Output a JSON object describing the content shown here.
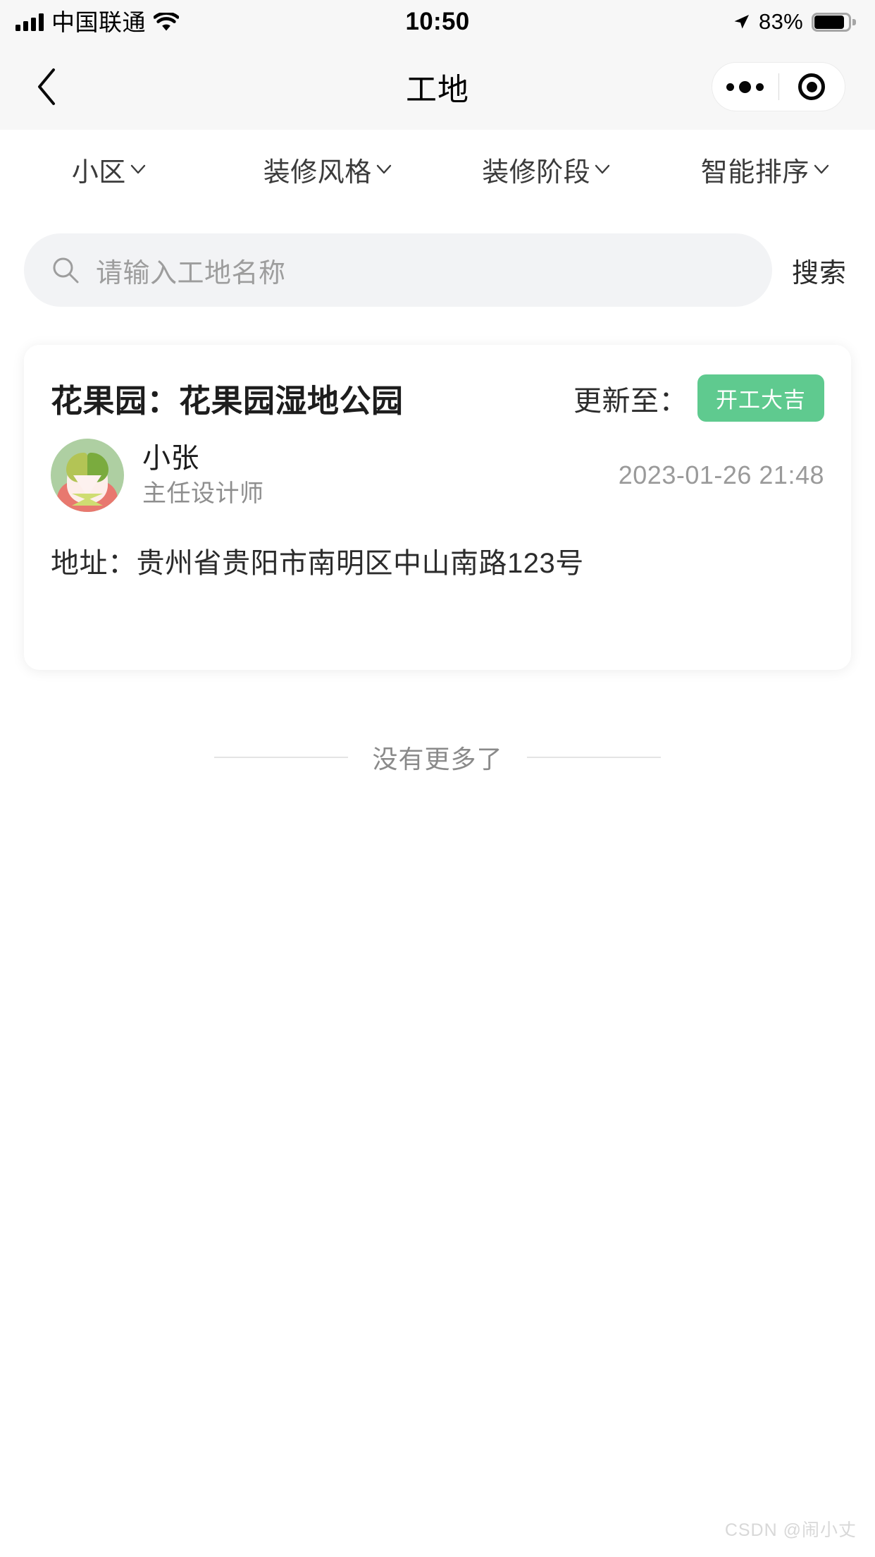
{
  "status_bar": {
    "carrier": "中国联通",
    "time": "10:50",
    "battery_percent": "83%",
    "signal_icon": "signal-bars-icon",
    "wifi_icon": "wifi-icon",
    "location_icon": "location-arrow-icon",
    "battery_icon": "battery-icon"
  },
  "nav": {
    "title": "工地",
    "back_icon": "chevron-left-icon",
    "capsule": {
      "more_icon": "more-dots-icon",
      "target_icon": "target-circle-icon"
    }
  },
  "filters": [
    {
      "label": "小区",
      "icon": "chevron-down-icon"
    },
    {
      "label": "装修风格",
      "icon": "chevron-down-icon"
    },
    {
      "label": "装修阶段",
      "icon": "chevron-down-icon"
    },
    {
      "label": "智能排序",
      "icon": "chevron-down-icon"
    }
  ],
  "search": {
    "icon": "search-icon",
    "placeholder": "请输入工地名称",
    "value": "",
    "button_label": "搜索"
  },
  "site_card": {
    "title": "花果园：花果园湿地公园",
    "update_label": "更新至：",
    "stage_badge": "开工大吉",
    "stage_badge_color": "#5fca8f",
    "designer_name": "小张",
    "designer_role": "主任设计师",
    "timestamp": "2023-01-26 21:48",
    "address": "地址：贵州省贵阳市南明区中山南路123号",
    "avatar_icon": "avatar"
  },
  "list_footer": {
    "text": "没有更多了"
  },
  "watermark": {
    "text": "CSDN @闹小丈"
  }
}
